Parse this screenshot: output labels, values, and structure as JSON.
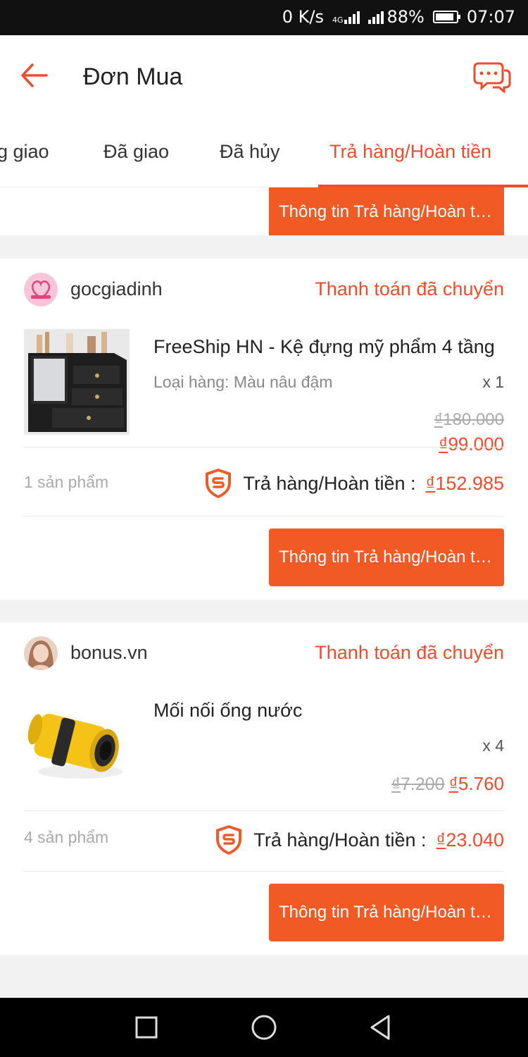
{
  "status_bar": {
    "speed": "0 K/s",
    "network": "4G",
    "battery": "88%",
    "battery_level": 0.88,
    "time": "07:07"
  },
  "header": {
    "title": "Đơn Mua",
    "back_icon": "arrow-left-icon",
    "chat_icon": "chat-bubbles-icon"
  },
  "tabs": [
    {
      "label": "g giao",
      "active": false
    },
    {
      "label": "Đã giao",
      "active": false
    },
    {
      "label": "Đã hủy",
      "active": false
    },
    {
      "label": "Trả hàng/Hoàn tiền",
      "active": true
    }
  ],
  "accent_color": "#ee4d2d",
  "button_color": "#f15a24",
  "partial_card": {
    "button_label": "Thông tin Trả hàng/Hoàn tiền"
  },
  "orders": [
    {
      "shop_name": "gocgiadinh",
      "status": "Thanh toán đã chuyển",
      "product_name": "FreeShip HN - Kệ đựng mỹ phẩm 4 tầng",
      "variation": "Loại hàng: Màu nâu đậm",
      "quantity": "x 1",
      "currency": "₫",
      "original_price": "180.000",
      "price": "99.000",
      "item_count": "1 sản phẩm",
      "refund_label": "Trả hàng/Hoàn tiền :",
      "refund_amount": "152.985",
      "button_label": "Thông tin Trả hàng/Hoàn tiền"
    },
    {
      "shop_name": "bonus.vn",
      "status": "Thanh toán đã chuyển",
      "product_name": "Mối nối ống nước",
      "quantity": "x 4",
      "currency": "₫",
      "original_price": "7.200",
      "price": "5.760",
      "item_count": "4 sản phẩm",
      "refund_label": "Trả hàng/Hoàn tiền :",
      "refund_amount": "23.040",
      "button_label": "Thông tin Trả hàng/Hoàn tiền"
    }
  ],
  "nav_bar": {
    "icons": [
      "recent-apps-icon",
      "home-icon",
      "back-icon"
    ]
  }
}
